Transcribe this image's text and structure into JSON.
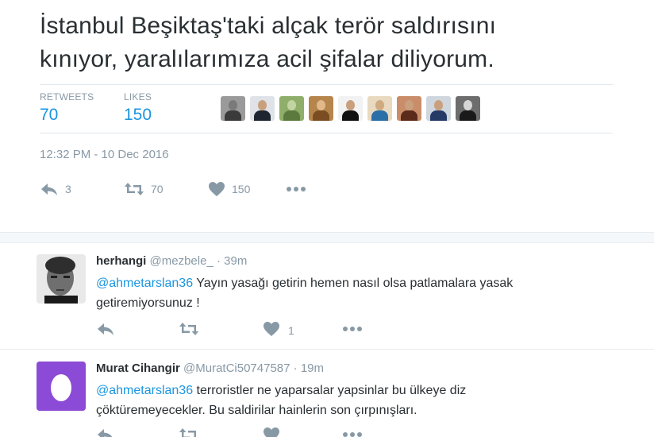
{
  "main_tweet": {
    "text_line1": "İstanbul Beşiktaş'taki alçak terör saldırısını",
    "text_line2": "kınıyor, yaralılarımıza acil şifalar diliyorum.",
    "stats": {
      "retweets_label": "RETWEETS",
      "retweets_value": "70",
      "likes_label": "LIKES",
      "likes_value": "150"
    },
    "liker_avatar_count": 10,
    "timestamp": "12:32 PM - 10 Dec 2016",
    "actions": {
      "reply_count": "3",
      "retweet_count": "70",
      "like_count": "150"
    }
  },
  "replies": [
    {
      "name": "herhangi",
      "handle": "@mezbele_",
      "separator": "·",
      "time": "39m",
      "mention": "@ahmetarslan36",
      "text_line1_rest": " Yayın yasağı getirin hemen nasıl olsa patlamalara yasak",
      "text_line2": "getiremiyorsunuz !",
      "like_count": "1"
    },
    {
      "name": "Murat Cihangir",
      "handle": "@MuratCi50747587",
      "separator": "·",
      "time": "19m",
      "mention": "@ahmetarslan36",
      "text_line1_rest": " terroristler ne yaparsalar yapsinlar bu ülkeye diz",
      "text_line2": "çöktüremeyecekler. Bu saldirilar hainlerin son çırpınışları.",
      "like_count": ""
    }
  ],
  "colors": {
    "accent": "#1b95e0",
    "muted": "#8899a6",
    "text": "#292f33",
    "egg_avatar": "#8c4bd6"
  },
  "icons": [
    "reply-icon",
    "retweet-icon",
    "heart-icon",
    "more-icon",
    "egg-avatar-icon"
  ]
}
